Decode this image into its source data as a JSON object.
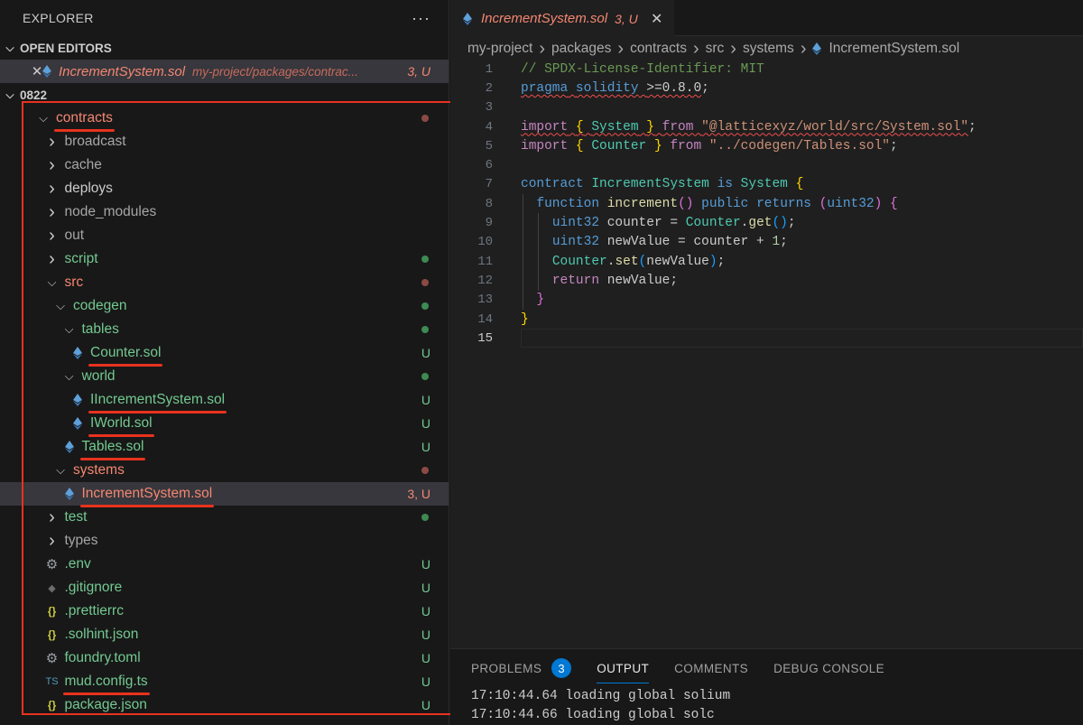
{
  "sidebar": {
    "title": "EXPLORER",
    "more": "···",
    "open_editors": {
      "label": "OPEN EDITORS",
      "item": {
        "name": "IncrementSystem.sol",
        "path": "my-project/packages/contrac...",
        "badge": "3, U",
        "close": "✕"
      }
    },
    "workspace": {
      "label": "0822"
    },
    "tree": [
      {
        "label": "contracts",
        "indent": 0,
        "type": "folder-open",
        "color": "red",
        "marker": "dot-red",
        "underline": true
      },
      {
        "label": "broadcast",
        "indent": 1,
        "type": "folder",
        "color": "dim"
      },
      {
        "label": "cache",
        "indent": 1,
        "type": "folder",
        "color": "dim"
      },
      {
        "label": "deploys",
        "indent": 1,
        "type": "folder",
        "color": "plain"
      },
      {
        "label": "node_modules",
        "indent": 1,
        "type": "folder",
        "color": "dim"
      },
      {
        "label": "out",
        "indent": 1,
        "type": "folder",
        "color": "dim"
      },
      {
        "label": "script",
        "indent": 1,
        "type": "folder",
        "color": "green",
        "marker": "dot-green"
      },
      {
        "label": "src",
        "indent": 1,
        "type": "folder-open",
        "color": "red",
        "marker": "dot-red"
      },
      {
        "label": "codegen",
        "indent": 2,
        "type": "folder-open",
        "color": "green",
        "marker": "dot-green"
      },
      {
        "label": "tables",
        "indent": 3,
        "type": "folder-open",
        "color": "green",
        "marker": "dot-green"
      },
      {
        "label": "Counter.sol",
        "indent": 4,
        "type": "sol",
        "color": "green",
        "badge": "U",
        "underline": true
      },
      {
        "label": "world",
        "indent": 3,
        "type": "folder-open",
        "color": "green",
        "marker": "dot-green"
      },
      {
        "label": "IIncrementSystem.sol",
        "indent": 4,
        "type": "sol",
        "color": "green",
        "badge": "U",
        "underline": true
      },
      {
        "label": "IWorld.sol",
        "indent": 4,
        "type": "sol",
        "color": "green",
        "badge": "U",
        "underline": true
      },
      {
        "label": "Tables.sol",
        "indent": 3,
        "type": "sol",
        "color": "green",
        "badge": "U",
        "underline": true
      },
      {
        "label": "systems",
        "indent": 2,
        "type": "folder-open",
        "color": "red",
        "marker": "dot-red"
      },
      {
        "label": "IncrementSystem.sol",
        "indent": 3,
        "type": "sol",
        "color": "red",
        "badge": "3, U",
        "underline": true,
        "selected": true
      },
      {
        "label": "test",
        "indent": 1,
        "type": "folder",
        "color": "green",
        "marker": "dot-green"
      },
      {
        "label": "types",
        "indent": 1,
        "type": "folder",
        "color": "dim"
      },
      {
        "label": ".env",
        "indent": 1,
        "type": "gear",
        "color": "green",
        "badge": "U"
      },
      {
        "label": ".gitignore",
        "indent": 1,
        "type": "git",
        "color": "green",
        "badge": "U"
      },
      {
        "label": ".prettierrc",
        "indent": 1,
        "type": "json",
        "color": "green",
        "badge": "U"
      },
      {
        "label": ".solhint.json",
        "indent": 1,
        "type": "json",
        "color": "green",
        "badge": "U"
      },
      {
        "label": "foundry.toml",
        "indent": 1,
        "type": "gear",
        "color": "green",
        "badge": "U"
      },
      {
        "label": "mud.config.ts",
        "indent": 1,
        "type": "ts",
        "color": "green",
        "badge": "U",
        "underline": true
      },
      {
        "label": "package.json",
        "indent": 1,
        "type": "json",
        "color": "green",
        "badge": "U"
      }
    ]
  },
  "editor": {
    "tab": {
      "name": "IncrementSystem.sol",
      "badge": "3, U",
      "close": "✕"
    },
    "breadcrumb": [
      "my-project",
      "packages",
      "contracts",
      "src",
      "systems"
    ],
    "breadcrumb_file": "IncrementSystem.sol",
    "active_line": 15,
    "lines": [
      [
        {
          "t": "// SPDX-License-Identifier: MIT",
          "c": "cmt"
        }
      ],
      [
        {
          "t": "pragma",
          "c": "kw",
          "sq": true
        },
        {
          "t": " ",
          "c": "",
          "sq": true
        },
        {
          "t": "solidity",
          "c": "kw",
          "sq": true
        },
        {
          "t": " ",
          "c": "",
          "sq": true
        },
        {
          "t": ">=0.8.0",
          "c": "",
          "sq": true
        },
        {
          "t": ";",
          "c": ""
        }
      ],
      [],
      [
        {
          "t": "import",
          "c": "ctl",
          "sq": true
        },
        {
          "t": " ",
          "c": "",
          "sq": true
        },
        {
          "t": "{",
          "c": "brk1",
          "sq": true
        },
        {
          "t": " ",
          "c": "",
          "sq": true
        },
        {
          "t": "System",
          "c": "cls",
          "sq": true
        },
        {
          "t": " ",
          "c": "",
          "sq": true
        },
        {
          "t": "}",
          "c": "brk1",
          "sq": true
        },
        {
          "t": " ",
          "c": "",
          "sq": true
        },
        {
          "t": "from",
          "c": "ctl",
          "sq": true
        },
        {
          "t": " ",
          "c": "",
          "sq": true
        },
        {
          "t": "\"@latticexyz/world/src/System.sol\"",
          "c": "str",
          "sq": true
        },
        {
          "t": ";",
          "c": ""
        }
      ],
      [
        {
          "t": "import",
          "c": "ctl"
        },
        {
          "t": " ",
          "c": ""
        },
        {
          "t": "{",
          "c": "brk1"
        },
        {
          "t": " ",
          "c": ""
        },
        {
          "t": "Counter",
          "c": "cls"
        },
        {
          "t": " ",
          "c": ""
        },
        {
          "t": "}",
          "c": "brk1"
        },
        {
          "t": " ",
          "c": ""
        },
        {
          "t": "from",
          "c": "ctl"
        },
        {
          "t": " ",
          "c": ""
        },
        {
          "t": "\"../codegen/Tables.sol\"",
          "c": "str"
        },
        {
          "t": ";",
          "c": ""
        }
      ],
      [],
      [
        {
          "t": "contract",
          "c": "kw"
        },
        {
          "t": " ",
          "c": ""
        },
        {
          "t": "IncrementSystem",
          "c": "cls"
        },
        {
          "t": " ",
          "c": ""
        },
        {
          "t": "is",
          "c": "kw"
        },
        {
          "t": " ",
          "c": ""
        },
        {
          "t": "System",
          "c": "cls"
        },
        {
          "t": " ",
          "c": ""
        },
        {
          "t": "{",
          "c": "brk1"
        }
      ],
      [
        {
          "t": "  ",
          "c": ""
        },
        {
          "t": "function",
          "c": "kw"
        },
        {
          "t": " ",
          "c": ""
        },
        {
          "t": "increment",
          "c": "fn"
        },
        {
          "t": "()",
          "c": "brk2"
        },
        {
          "t": " ",
          "c": ""
        },
        {
          "t": "public",
          "c": "kw"
        },
        {
          "t": " ",
          "c": ""
        },
        {
          "t": "returns",
          "c": "kw"
        },
        {
          "t": " ",
          "c": ""
        },
        {
          "t": "(",
          "c": "brk2"
        },
        {
          "t": "uint32",
          "c": "kw"
        },
        {
          "t": ")",
          "c": "brk2"
        },
        {
          "t": " ",
          "c": ""
        },
        {
          "t": "{",
          "c": "brk2"
        }
      ],
      [
        {
          "t": "    ",
          "c": ""
        },
        {
          "t": "uint32",
          "c": "kw"
        },
        {
          "t": " counter = ",
          "c": ""
        },
        {
          "t": "Counter",
          "c": "cls"
        },
        {
          "t": ".",
          "c": ""
        },
        {
          "t": "get",
          "c": "fn"
        },
        {
          "t": "()",
          "c": "brk3"
        },
        {
          "t": ";",
          "c": ""
        }
      ],
      [
        {
          "t": "    ",
          "c": ""
        },
        {
          "t": "uint32",
          "c": "kw"
        },
        {
          "t": " newValue = counter + ",
          "c": ""
        },
        {
          "t": "1",
          "c": "num"
        },
        {
          "t": ";",
          "c": ""
        }
      ],
      [
        {
          "t": "    ",
          "c": ""
        },
        {
          "t": "Counter",
          "c": "cls"
        },
        {
          "t": ".",
          "c": ""
        },
        {
          "t": "set",
          "c": "fn"
        },
        {
          "t": "(",
          "c": "brk3"
        },
        {
          "t": "newValue",
          "c": ""
        },
        {
          "t": ")",
          "c": "brk3"
        },
        {
          "t": ";",
          "c": ""
        }
      ],
      [
        {
          "t": "    ",
          "c": ""
        },
        {
          "t": "return",
          "c": "ctl"
        },
        {
          "t": " newValue;",
          "c": ""
        }
      ],
      [
        {
          "t": "  ",
          "c": ""
        },
        {
          "t": "}",
          "c": "brk2"
        }
      ],
      [
        {
          "t": "}",
          "c": "brk1"
        }
      ],
      []
    ]
  },
  "panel": {
    "tabs": [
      {
        "label": "PROBLEMS",
        "badge": "3"
      },
      {
        "label": "OUTPUT",
        "active": true
      },
      {
        "label": "COMMENTS"
      },
      {
        "label": "DEBUG CONSOLE"
      }
    ],
    "output": [
      "17:10:44.64 loading global solium",
      "17:10:44.66 loading global solc"
    ]
  },
  "colors": {
    "accent": "#0078d4",
    "error": "#f48771",
    "untracked": "#73c991",
    "annotation": "#e8321e"
  }
}
